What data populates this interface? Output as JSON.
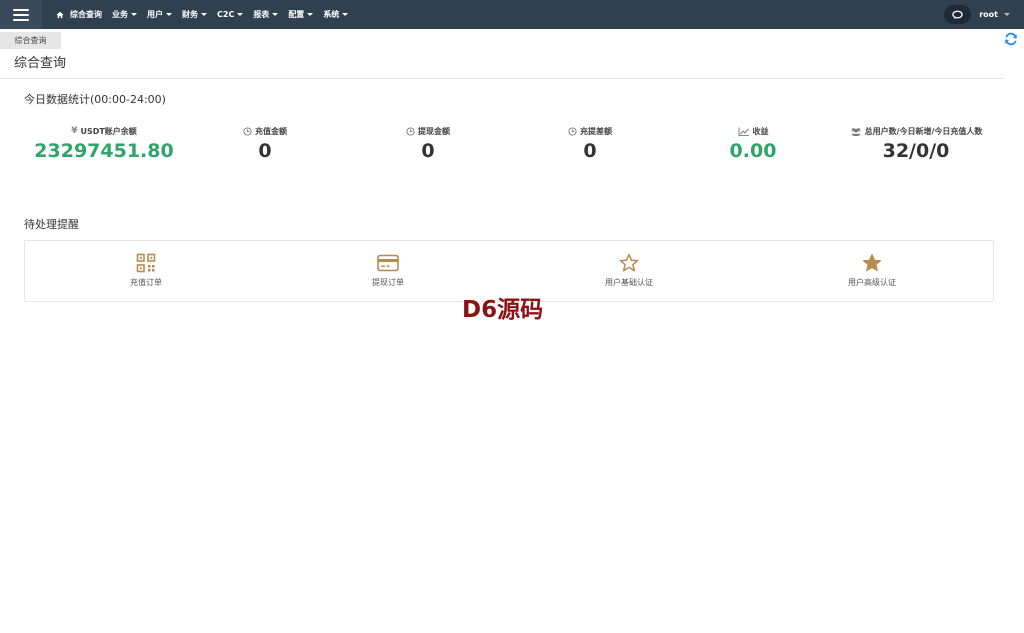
{
  "nav": {
    "items": [
      {
        "label": "综合查询",
        "has_caret": false
      },
      {
        "label": "业务",
        "has_caret": true
      },
      {
        "label": "用户",
        "has_caret": true
      },
      {
        "label": "财务",
        "has_caret": true
      },
      {
        "label": "C2C",
        "has_caret": true
      },
      {
        "label": "报表",
        "has_caret": true
      },
      {
        "label": "配置",
        "has_caret": true
      },
      {
        "label": "系统",
        "has_caret": true
      }
    ],
    "user": "root"
  },
  "tabs": {
    "active": "综合查询"
  },
  "page": {
    "title": "综合查询"
  },
  "today": {
    "title": "今日数据统计(00:00-24:00)",
    "stats": [
      {
        "label": "USDT账户余额",
        "value": "23297451.80",
        "icon": "yen-icon"
      },
      {
        "label": "充值金额",
        "value": "0",
        "icon": "clock-icon"
      },
      {
        "label": "提现金额",
        "value": "0",
        "icon": "clock-icon"
      },
      {
        "label": "充提差额",
        "value": "0",
        "icon": "clock-icon"
      },
      {
        "label": "收益",
        "value": "0.00",
        "icon": "chart-line-icon"
      },
      {
        "label": "总用户数/今日新增/今日充值人数",
        "value": "32/0/0",
        "icon": "users-icon"
      }
    ]
  },
  "pending": {
    "title": "待处理提醒",
    "items": [
      {
        "label": "充值订单",
        "icon": "qrcode-icon"
      },
      {
        "label": "提现订单",
        "icon": "credit-card-icon"
      },
      {
        "label": "用户基础认证",
        "icon": "star-outline-icon"
      },
      {
        "label": "用户高级认证",
        "icon": "star-filled-icon"
      }
    ]
  },
  "watermark": "D6源码",
  "colors": {
    "topbar": "#2f4050",
    "accent_green": "#2fa56a",
    "icon_brown": "#b88a4e",
    "watermark": "#8b1212"
  }
}
